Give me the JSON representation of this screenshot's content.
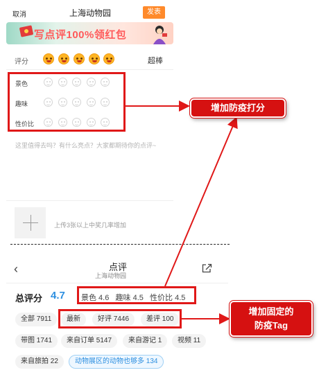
{
  "edit_screen": {
    "cancel_label": "取消",
    "title": "上海动物园",
    "publish_label": "发表",
    "banner_text": "写点评100%领红包",
    "rating_label": "评分",
    "rating_word": "超棒",
    "rating_value": 5,
    "sub_ratings": [
      {
        "label": "景色"
      },
      {
        "label": "趣味"
      },
      {
        "label": "性价比"
      }
    ],
    "placeholder": "这里值得去吗？有什么亮点？大家都期待你的点评~",
    "photo_hint": "上传3张以上中奖几率增加"
  },
  "review_screen": {
    "title": "点评",
    "subtitle": "上海动物园",
    "total_label": "总评分",
    "total_score": "4.7",
    "sub_scores": "景色 4.6   趣味 4.5   性价比 4.5",
    "tags_row1": [
      "全部 7911",
      "最新",
      "好评 7446",
      "差评 100"
    ],
    "tags_row2": [
      "带图 1741",
      "来自订单 5147",
      "来自游记 1",
      "视频 11"
    ],
    "tags_row3": [
      "来自旅拍 22",
      "动物展区的动物也够多 134"
    ]
  },
  "annotations": {
    "callout_1": "增加防疫打分",
    "callout_2_line1": "增加固定的",
    "callout_2_line2": "防疫Tag"
  },
  "colors": {
    "accent_orange": "#ff8a2b",
    "score_blue": "#2d8fe0",
    "annotation_red": "#d61111"
  }
}
